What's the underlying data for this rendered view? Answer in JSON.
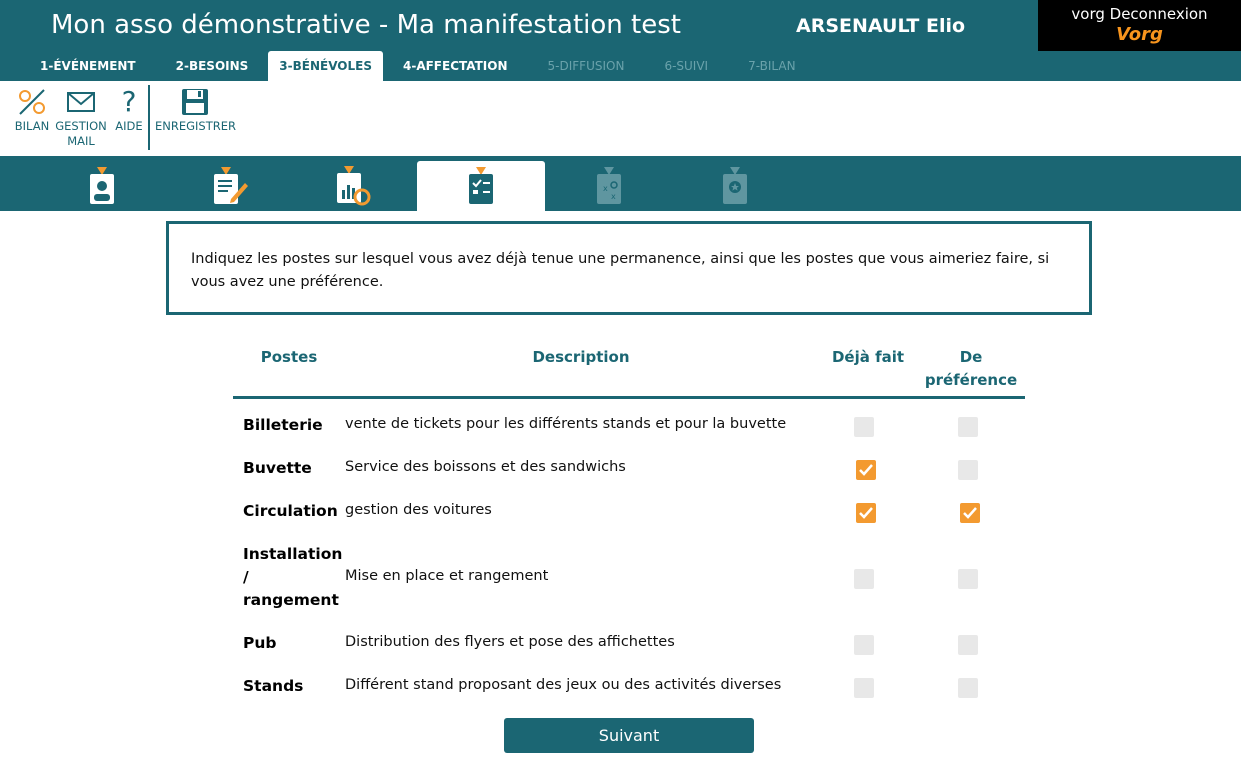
{
  "header": {
    "title": "Mon asso démonstrative - Ma manifestation test",
    "user": "ARSENAULT Elio",
    "logout_label": "vorg Deconnexion",
    "logo_text": "Vorg",
    "accent_color": "#1b6673",
    "logo_color": "#f7941d"
  },
  "steps": [
    {
      "label": "1-ÉVÉNEMENT",
      "state": "enabled"
    },
    {
      "label": "2-BESOINS",
      "state": "enabled"
    },
    {
      "label": "3-BÉNÉVOLES",
      "state": "active"
    },
    {
      "label": "4-AFFECTATION",
      "state": "enabled"
    },
    {
      "label": "5-DIFFUSION",
      "state": "disabled"
    },
    {
      "label": "6-SUIVI",
      "state": "disabled"
    },
    {
      "label": "7-BILAN",
      "state": "disabled"
    }
  ],
  "toolbar": {
    "bilan": "BILAN",
    "gestion_mail_1": "GESTION",
    "gestion_mail_2": "MAIL",
    "aide": "AIDE",
    "enregistrer": "ENREGISTRER"
  },
  "icon_tabs": [
    "badge-person-icon",
    "badge-edit-icon",
    "badge-chart-icon",
    "badge-checklist-icon",
    "badge-strategy-icon",
    "badge-star-icon"
  ],
  "info_text": "Indiquez les postes sur lesquel vous avez déjà tenue une permanence, ainsi que les postes que vous aimeriez faire, si vous avez une préférence.",
  "table": {
    "col_postes": "Postes",
    "col_description": "Description",
    "col_deja_fait": "Déjà fait",
    "col_preference_1": "De",
    "col_preference_2": "préférence",
    "rows": [
      {
        "poste": "Billeterie",
        "description": "vente de tickets pour les différents stands et pour la buvette",
        "deja_fait": false,
        "preference": false
      },
      {
        "poste": "Buvette",
        "description": "Service des boissons et des sandwichs",
        "deja_fait": true,
        "preference": false
      },
      {
        "poste": "Circulation",
        "description": "gestion des voitures",
        "deja_fait": true,
        "preference": true
      },
      {
        "poste_1": "Installation",
        "poste_2": "/",
        "poste_3": "rangement",
        "description": "Mise en place et rangement",
        "deja_fait": false,
        "preference": false
      },
      {
        "poste": "Pub",
        "description": "Distribution des flyers et pose des affichettes",
        "deja_fait": false,
        "preference": false
      },
      {
        "poste": "Stands",
        "description": "Différent stand proposant des jeux ou des activités diverses",
        "deja_fait": false,
        "preference": false
      }
    ]
  },
  "next_button": "Suivant",
  "checkbox_checked_color": "#f39a30"
}
